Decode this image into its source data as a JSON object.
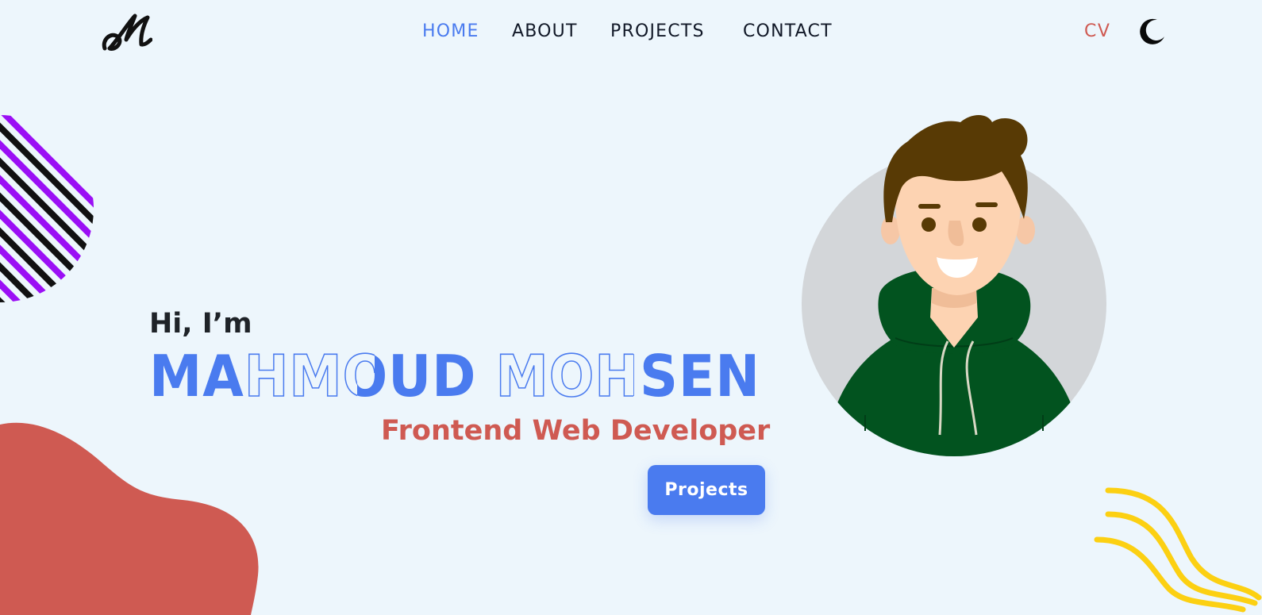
{
  "header": {
    "logo_text": "M",
    "nav": [
      {
        "label": "HOME",
        "active": true
      },
      {
        "label": "ABOUT",
        "active": false
      },
      {
        "label": "PROJECTS",
        "active": false
      },
      {
        "label": "CONTACT",
        "active": false
      }
    ],
    "cv_label": "CV",
    "theme_toggle_icon": "moon-icon"
  },
  "hero": {
    "greeting": "Hi, I’m",
    "name": "MAHMOUD MOHSEN",
    "role": "Frontend Web Developer",
    "projects_button_label": "Projects"
  },
  "colors": {
    "background": "#edf6fc",
    "accent_blue": "#4a7bef",
    "accent_red": "#cf5a52",
    "nav_text": "#111827",
    "deco_purple": "#9b0ff5",
    "deco_yellow": "#fcd012",
    "avatar_bg": "#d3d6d9",
    "hoodie_green": "#02531f",
    "hair_brown": "#583a05"
  },
  "icons": {
    "logo": "m-signature-logo",
    "theme": "moon-icon"
  }
}
